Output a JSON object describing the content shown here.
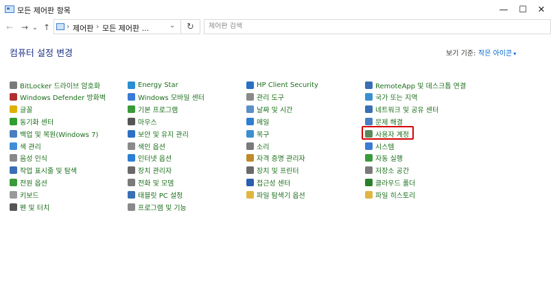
{
  "window": {
    "title": "모든 제어판 항목"
  },
  "titlebar": {
    "minimize_glyph": "—",
    "maximize_glyph": "☐",
    "close_glyph": "✕"
  },
  "nav": {
    "back_glyph": "←",
    "forward_glyph": "→",
    "dropdown_glyph": "⌄",
    "up_glyph": "↑",
    "refresh_glyph": "↻"
  },
  "address": {
    "crumbs": [
      "제어판",
      "모든 제어판 ..."
    ],
    "sep_glyph": "›",
    "dropdown_glyph": "⌄"
  },
  "search": {
    "placeholder": "제어판 검색",
    "value": ""
  },
  "header": {
    "title": "컴퓨터 설정 변경",
    "view_label": "보기 기준:",
    "view_value": "작은 아이콘",
    "view_caret": "▾"
  },
  "columns": [
    {
      "items": [
        {
          "label": "BitLocker 드라이브 암호화",
          "icon": "bitlocker-icon",
          "color": "#7a7a7a"
        },
        {
          "label": "Windows Defender 방화벽",
          "icon": "firewall-icon",
          "color": "#b03030"
        },
        {
          "label": "글꼴",
          "icon": "fonts-icon",
          "color": "#e0b000"
        },
        {
          "label": "동기화 센터",
          "icon": "sync-center-icon",
          "color": "#2e9e2e"
        },
        {
          "label": "백업 및 복원(Windows 7)",
          "icon": "backup-icon",
          "color": "#4a7fc1"
        },
        {
          "label": "색 관리",
          "icon": "color-management-icon",
          "color": "#3f8fd8"
        },
        {
          "label": "음성 인식",
          "icon": "speech-recognition-icon",
          "color": "#888888"
        },
        {
          "label": "작업 표시줄 및 탐색",
          "icon": "taskbar-icon",
          "color": "#3a6fb5"
        },
        {
          "label": "전원 옵션",
          "icon": "power-options-icon",
          "color": "#3a9a3a"
        },
        {
          "label": "키보드",
          "icon": "keyboard-icon",
          "color": "#9a9a9a"
        },
        {
          "label": "펜 및 터치",
          "icon": "pen-touch-icon",
          "color": "#555555"
        }
      ]
    },
    {
      "items": [
        {
          "label": "Energy Star",
          "icon": "energy-star-icon",
          "color": "#2a8fd0"
        },
        {
          "label": "Windows 모바일 센터",
          "icon": "mobility-center-icon",
          "color": "#3a7bd5"
        },
        {
          "label": "기본 프로그램",
          "icon": "default-programs-icon",
          "color": "#3a9a3a"
        },
        {
          "label": "마우스",
          "icon": "mouse-icon",
          "color": "#555555"
        },
        {
          "label": "보안 및 유지 관리",
          "icon": "security-maintenance-icon",
          "color": "#2e6fc4"
        },
        {
          "label": "색인 옵션",
          "icon": "indexing-options-icon",
          "color": "#8a8a8a"
        },
        {
          "label": "인터넷 옵션",
          "icon": "internet-options-icon",
          "color": "#2d7fd3"
        },
        {
          "label": "장치 관리자",
          "icon": "device-manager-icon",
          "color": "#6a6a6a"
        },
        {
          "label": "전화 및 모뎀",
          "icon": "phone-modem-icon",
          "color": "#7a7a7a"
        },
        {
          "label": "태블릿 PC 설정",
          "icon": "tablet-pc-icon",
          "color": "#3a6fb5"
        },
        {
          "label": "프로그램 및 기능",
          "icon": "programs-features-icon",
          "color": "#8a8a8a"
        }
      ]
    },
    {
      "items": [
        {
          "label": "HP Client Security",
          "icon": "hp-client-security-icon",
          "color": "#2a6fc4"
        },
        {
          "label": "관리 도구",
          "icon": "admin-tools-icon",
          "color": "#8a8a8a"
        },
        {
          "label": "날짜 및 시간",
          "icon": "date-time-icon",
          "color": "#5a8fc8"
        },
        {
          "label": "메일",
          "icon": "mail-icon",
          "color": "#2f7fd0"
        },
        {
          "label": "복구",
          "icon": "recovery-icon",
          "color": "#3a8fd0"
        },
        {
          "label": "소리",
          "icon": "sound-icon",
          "color": "#7a7a7a"
        },
        {
          "label": "자격 증명 관리자",
          "icon": "credential-manager-icon",
          "color": "#c08a2a"
        },
        {
          "label": "장치 및 프린터",
          "icon": "devices-printers-icon",
          "color": "#6a6a6a"
        },
        {
          "label": "접근성 센터",
          "icon": "ease-of-access-icon",
          "color": "#2a5fb0"
        },
        {
          "label": "파일 탐색기 옵션",
          "icon": "file-explorer-options-icon",
          "color": "#e0b640"
        }
      ]
    },
    {
      "items": [
        {
          "label": "RemoteApp 및 데스크톱 연결",
          "icon": "remoteapp-icon",
          "color": "#3a6fb5"
        },
        {
          "label": "국가 또는 지역",
          "icon": "region-icon",
          "color": "#3a8fd0"
        },
        {
          "label": "네트워크 및 공유 센터",
          "icon": "network-sharing-icon",
          "color": "#3a6fb5"
        },
        {
          "label": "문제 해결",
          "icon": "troubleshooting-icon",
          "color": "#4a7fc1"
        },
        {
          "label": "사용자 계정",
          "icon": "user-accounts-icon",
          "color": "#5a8a5a"
        },
        {
          "label": "시스템",
          "icon": "system-icon",
          "color": "#3a7bd5"
        },
        {
          "label": "자동 실행",
          "icon": "autoplay-icon",
          "color": "#3a9a3a"
        },
        {
          "label": "저장소 공간",
          "icon": "storage-spaces-icon",
          "color": "#7a7a7a"
        },
        {
          "label": "클라우드 폴더",
          "icon": "work-folders-icon",
          "color": "#2a7f2a"
        },
        {
          "label": "파일 히스토리",
          "icon": "file-history-icon",
          "color": "#e0b640"
        }
      ]
    }
  ]
}
